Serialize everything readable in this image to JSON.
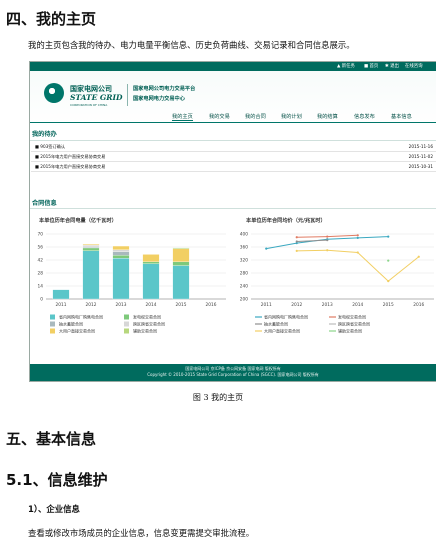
{
  "doc": {
    "h_main": "四、我的主页",
    "intro": "我的主页包含我的待办、电力电量平衡信息、历史负荷曲线、交易记录和合同信息展示。",
    "caption": "图 3  我的主页",
    "h_basic": "五、基本信息",
    "h_maint": "5.1、信息维护",
    "h_company": "1）、企业信息",
    "company_text": "查看或修改市场成员的企业信息，信息变更需提交审批流程。"
  },
  "screenshot": {
    "topbar": [
      "▲ 新任务",
      "■ 首页",
      "✱ 退出",
      "在线咨询"
    ],
    "logo_cn": "国家电网公司",
    "logo_en": "STATE GRID",
    "logo_sub": "CORPORATION OF CHINA",
    "platform_line1": "国家电网公司电力交易平台",
    "platform_line2": "国家电网电力交易中心",
    "nav": [
      "我的主页",
      "我的交易",
      "我的合同",
      "我的计划",
      "我的结算",
      "信息发布",
      "基本信息"
    ],
    "todo_title": "我的待办",
    "todos": [
      {
        "text": "■ 903签订确认",
        "date": "2015-11-16"
      },
      {
        "text": "■ 2015年电力用户直接交易协商交易",
        "date": "2015-11-02"
      },
      {
        "text": "■ 2015年电力用户直接交易协商交易",
        "date": "2015-10-31"
      }
    ],
    "contract_title": "合同信息",
    "footer_line1": "国家电网公司 京ICP备 京公网安备 国家电网 版权所有",
    "footer_line2": "Copyright © 2010-2015 State Grid Corporation of China (SGCC). 国家电网公司 版权所有"
  },
  "chart_data": [
    {
      "type": "bar",
      "title": "本单位历年合同电量（亿千瓦时）",
      "categories": [
        "2011",
        "2012",
        "2013",
        "2014",
        "2015",
        "2016"
      ],
      "ylim": [
        0,
        70
      ],
      "yticks": [
        0,
        14,
        28,
        42,
        56,
        70
      ],
      "series": [
        {
          "name": "省内网购电厂购售电合同",
          "color": "#5bc6c9",
          "values": [
            10,
            52,
            44,
            38,
            36,
            0
          ]
        },
        {
          "name": "发电权交易合同",
          "color": "#7ec97b",
          "values": [
            0,
            3,
            3,
            2,
            4,
            0
          ]
        },
        {
          "name": "抽水蓄能合同",
          "color": "#a9b9bd",
          "values": [
            0,
            1,
            4,
            0,
            0,
            0
          ]
        },
        {
          "name": "跨区跨省交易合同",
          "color": "#d7d7d7",
          "values": [
            0,
            2,
            2,
            0,
            0,
            0
          ]
        },
        {
          "name": "大用户直接交易合同",
          "color": "#f2cf63",
          "values": [
            0,
            1,
            4,
            8,
            14,
            0
          ]
        },
        {
          "name": "辅助交易合同",
          "color": "#b7d77d",
          "values": [
            0,
            0,
            0,
            0,
            1,
            0
          ]
        }
      ]
    },
    {
      "type": "line",
      "title": "本单位历年合同均价（元/兆瓦时）",
      "categories": [
        "2011",
        "2012",
        "2013",
        "2014",
        "2015",
        "2016"
      ],
      "ylim": [
        200,
        400
      ],
      "yticks": [
        200,
        240,
        280,
        320,
        360,
        400
      ],
      "series": [
        {
          "name": "省内网购电厂购售电合同",
          "color": "#3aa8c0",
          "values": [
            355,
            372,
            384,
            388,
            392,
            null
          ]
        },
        {
          "name": "发电权交易合同",
          "color": "#e07b63",
          "values": [
            null,
            390,
            392,
            396,
            null,
            null
          ]
        },
        {
          "name": "抽水蓄能合同",
          "color": "#8f8f8f",
          "values": [
            null,
            377,
            381,
            null,
            null,
            null
          ]
        },
        {
          "name": "跨区跨省交易合同",
          "color": "#bcbcbc",
          "values": [
            null,
            null,
            null,
            null,
            null,
            null
          ]
        },
        {
          "name": "大用户直接交易合同",
          "color": "#f2cf63",
          "values": [
            null,
            348,
            350,
            343,
            255,
            330
          ]
        },
        {
          "name": "辅助交易合同",
          "color": "#8cd58a",
          "values": [
            null,
            null,
            null,
            null,
            318,
            null
          ]
        }
      ]
    }
  ]
}
